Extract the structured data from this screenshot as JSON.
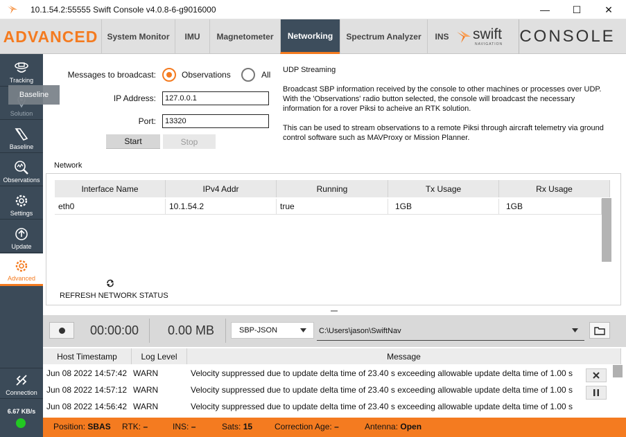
{
  "window": {
    "title": "10.1.54.2:55555 Swift Console v4.0.8-6-g9016000",
    "minimize_glyph": "—",
    "maximize_glyph": "☐",
    "close_glyph": "✕"
  },
  "header": {
    "brand": "ADVANCED",
    "tabs": [
      {
        "label": "System Monitor",
        "active": false
      },
      {
        "label": "IMU",
        "active": false
      },
      {
        "label": "Magnetometer",
        "active": false
      },
      {
        "label": "Networking",
        "active": true
      },
      {
        "label": "Spectrum Analyzer",
        "active": false
      },
      {
        "label": "INS",
        "active": false
      }
    ],
    "logo_text": "swift",
    "logo_subtext": "NAVIGATION",
    "console_label": "CONSOLE"
  },
  "sidebar": {
    "items": [
      {
        "label": "Tracking",
        "icon": "tracking-icon"
      },
      {
        "label": "Solution",
        "icon": "solution-icon"
      },
      {
        "label": "Baseline",
        "icon": "baseline-icon"
      },
      {
        "label": "Observations",
        "icon": "observations-icon"
      },
      {
        "label": "Settings",
        "icon": "settings-icon"
      },
      {
        "label": "Update",
        "icon": "update-icon"
      },
      {
        "label": "Advanced",
        "icon": "advanced-icon",
        "active": true
      }
    ],
    "tooltip": "Baseline",
    "connection_label": "Connection",
    "data_rate": "6.67 KB/s",
    "status_color": "#22c822"
  },
  "networking": {
    "messages_label": "Messages to broadcast:",
    "radio_observations": "Observations",
    "radio_all": "All",
    "selected": "Observations",
    "ip_label": "IP Address:",
    "ip_value": "127.0.0.1",
    "port_label": "Port:",
    "port_value": "13320",
    "start_label": "Start",
    "stop_label": "Stop",
    "info_title": "UDP Streaming",
    "info_p1_l1": "Broadcast SBP information received by the console to other machines or processes over UDP.",
    "info_p1_l2": "With the 'Observations' radio button selected, the console will broadcast the necessary",
    "info_p1_l3": "information for a rover Piksi to acheive an RTK solution.",
    "info_p2_l1": "This can be used to stream observations to a remote Piksi through aircraft telemetry via ground",
    "info_p2_l2": "control software such as MAVProxy or Mission Planner."
  },
  "network": {
    "section_label": "Network",
    "columns": [
      "Interface Name",
      "IPv4 Addr",
      "Running",
      "Tx Usage",
      "Rx Usage"
    ],
    "rows": [
      [
        "eth0",
        "10.1.54.2",
        "true",
        "1GB",
        "1GB"
      ]
    ],
    "refresh_label": "REFRESH NETWORK STATUS"
  },
  "recording": {
    "timer": "00:00:00",
    "size": "0.00 MB",
    "format": "SBP-JSON",
    "path": "C:\\Users\\jason\\SwiftNav"
  },
  "log": {
    "columns": [
      "Host Timestamp",
      "Log Level",
      "Message"
    ],
    "rows": [
      [
        "Jun 08 2022 14:57:42",
        "WARN",
        "Velocity suppressed due to update delta time of 23.40 s exceeding allowable update delta time of 1.00 s"
      ],
      [
        "Jun 08 2022 14:57:12",
        "WARN",
        "Velocity suppressed due to update delta time of 23.40 s exceeding allowable update delta time of 1.00 s"
      ],
      [
        "Jun 08 2022 14:56:42",
        "WARN",
        "Velocity suppressed due to update delta time of 23.40 s exceeding allowable update delta time of 1.00 s"
      ]
    ]
  },
  "status": {
    "position_label": "Position:",
    "position_value": "SBAS",
    "rtk_label": "RTK:",
    "rtk_value": "–",
    "ins_label": "INS:",
    "ins_value": "–",
    "sats_label": "Sats:",
    "sats_value": "15",
    "corr_label": "Correction Age:",
    "corr_value": "–",
    "antenna_label": "Antenna:",
    "antenna_value": "Open"
  },
  "colors": {
    "accent": "#f47b20",
    "sidebar": "#3b4a58",
    "active_tab": "#3d4d5c"
  }
}
